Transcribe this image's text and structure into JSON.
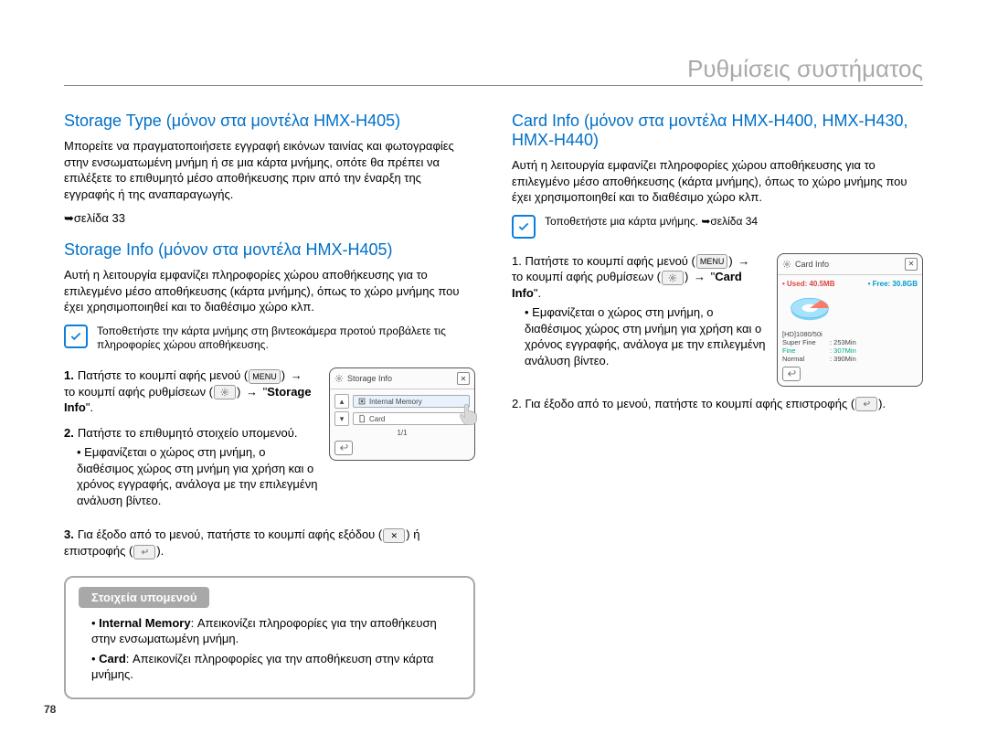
{
  "chapter_title": "Ρυθμίσεις συστήματος",
  "page_number": "78",
  "left": {
    "h_storage_type": "Storage Type (μόνον στα μοντέλα HMX-H405)",
    "p_storage_type": "Μπορείτε να πραγματοποιήσετε εγγραφή εικόνων ταινίας και φωτογραφίες στην ενσωματωμένη μνήμη ή σε μια κάρτα μνήμης, οπότε θα πρέπει να επιλέξετε το επιθυμητό μέσο αποθήκευσης πριν από την έναρξη της εγγραφής ή της αναπαραγωγής.",
    "p_storage_type_ref": "➥σελίδα 33",
    "h_storage_info": "Storage Info (μόνον στα μοντέλα HMX-H405)",
    "p_storage_info": "Αυτή η λειτουργία εμφανίζει πληροφορίες χώρου αποθήκευσης για το επιλεγμένο μέσο αποθήκευσης (κάρτα μνήμης), όπως το χώρο μνήμης που έχει χρησιμοποιηθεί και το διαθέσιμο χώρο κλπ.",
    "note": "Τοποθετήστε την κάρτα μνήμης στη βιντεοκάμερα προτού προβάλετε τις πληροφορίες χώρου αποθήκευσης.",
    "step1_a": "Πατήστε το κουμπί αφής μενού (",
    "step1_b": ") ",
    "step1_c": " το κουμπί αφής ρυθμίσεων (",
    "step1_d": ") ",
    "step1_e": " \"",
    "step1_f": "Storage Info",
    "step1_g": "\".",
    "step2": "Πατήστε το επιθυμητό στοιχείο υπομενού.",
    "sub2": "Εμφανίζεται ο χώρος στη μνήμη, ο διαθέσιμος χώρος στη μνήμη για χρήση και ο χρόνος εγγραφής, ανάλογα με την επιλεγμένη ανάλυση βίντεο.",
    "step3_a": "Για έξοδο από το μενού, πατήστε το κουμπί αφής εξόδου (",
    "step3_b": ") ή επιστροφής (",
    "step3_c": ").",
    "panel": {
      "title": "Storage Info",
      "opt1": "Internal Memory",
      "opt2": "Card",
      "page": "1/1"
    },
    "submenu_title": "Στοιχεία υπομενού",
    "sm1_a": "Internal Memory",
    "sm1_b": ": Απεικονίζει πληροφορίες για την αποθήκευση στην ενσωματωμένη μνήμη.",
    "sm2_a": "Card",
    "sm2_b": ": Απεικονίζει πληροφορίες για την αποθήκευση στην κάρτα μνήμης."
  },
  "right": {
    "h_card_info": "Card Info (μόνον στα μοντέλα HMX-H400, HMX-H430, HMX-H440)",
    "p_card_info": "Αυτή η λειτουργία εμφανίζει πληροφορίες χώρου αποθήκευσης για το επιλεγμένο μέσο αποθήκευσης (κάρτα μνήμης), όπως το χώρο μνήμης που έχει χρησιμοποιηθεί και το διαθέσιμο χώρο κλπ.",
    "note": "Τοποθετήστε μια κάρτα μνήμης. ➥σελίδα 34",
    "step1_a": "Πατήστε το κουμπί αφής μενού (",
    "step1_b": ") ",
    "step1_c": " το κουμπί αφής ρυθμίσεων (",
    "step1_d": ") ",
    "step1_e": " \"",
    "step1_f": "Card Info",
    "step1_g": "\".",
    "sub1": "Εμφανίζεται ο χώρος στη μνήμη, ο διαθέσιμος χώρος στη μνήμη για χρήση και ο χρόνος εγγραφής, ανάλογα με την επιλεγμένη ανάλυση βίντεο.",
    "step2_a": "Για έξοδο από το μενού, πατήστε το κουμπί αφής επιστροφής (",
    "step2_b": ").",
    "panel": {
      "title": "Card Info",
      "used_label": "Used: 40.5MB",
      "free_label": "Free: 30.8GB",
      "res_header": "[HD]1080/50i",
      "r1_l": "Super Fine",
      "r1_v": ": 253Min",
      "r2_l": "Fine",
      "r2_v": ": 307Min",
      "r3_l": "Normal",
      "r3_v": ": 390Min"
    }
  },
  "icons": {
    "menu_label": "MENU"
  }
}
